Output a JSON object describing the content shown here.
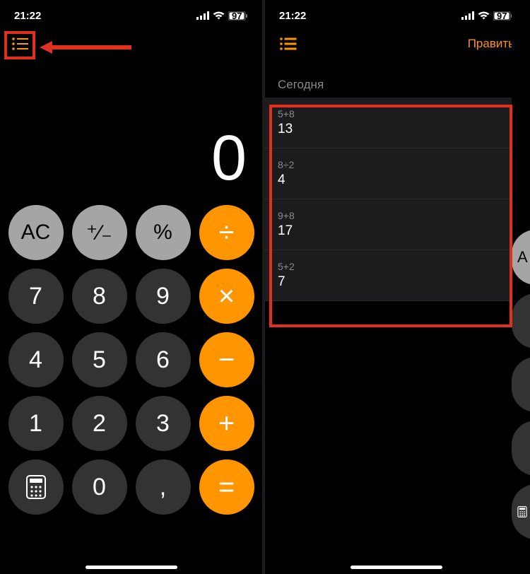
{
  "status": {
    "time": "21:22",
    "battery": "97"
  },
  "left": {
    "display_value": "0",
    "buttons": {
      "ac": "AC",
      "sign": "⁺∕₋",
      "percent": "%",
      "divide": "÷",
      "seven": "7",
      "eight": "8",
      "nine": "9",
      "multiply": "×",
      "four": "4",
      "five": "5",
      "six": "6",
      "minus": "−",
      "one": "1",
      "two": "2",
      "three": "3",
      "plus": "+",
      "zero": "0",
      "decimal": ",",
      "equals": "="
    }
  },
  "right": {
    "edit_label": "Править",
    "section_title": "Сегодня",
    "history": [
      {
        "expr": "5+8",
        "result": "13"
      },
      {
        "expr": "8÷2",
        "result": "4"
      },
      {
        "expr": "9+8",
        "result": "17"
      },
      {
        "expr": "5+2",
        "result": "7"
      }
    ]
  },
  "sliver": {
    "ac_partial": "A"
  }
}
